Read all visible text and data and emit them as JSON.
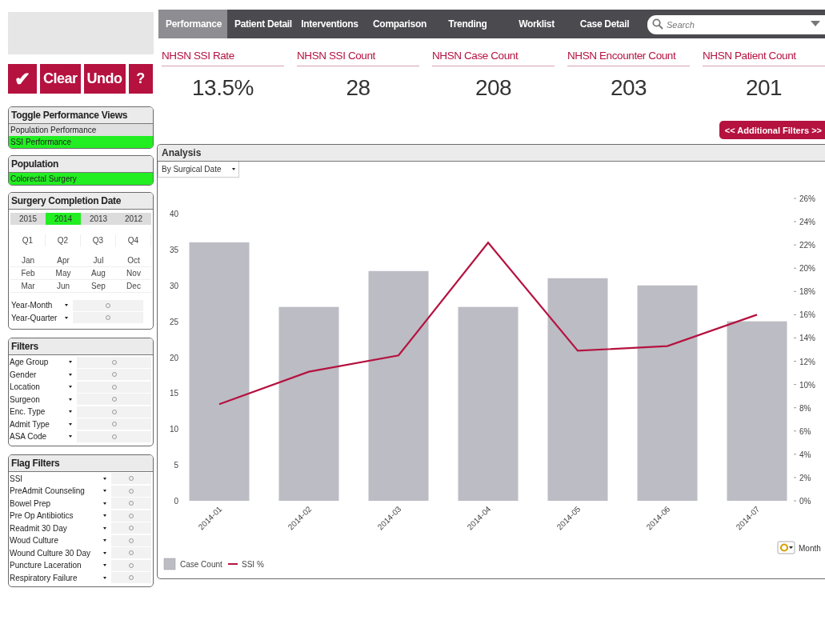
{
  "toolbar_buttons": [
    {
      "kind": "icon",
      "label": "✔"
    },
    {
      "kind": "text",
      "label": "Clear"
    },
    {
      "kind": "text",
      "label": "Undo"
    },
    {
      "kind": "text",
      "label": "?"
    }
  ],
  "sidebar": {
    "toggle_views": {
      "title": "Toggle Performance Views",
      "items": [
        {
          "label": "Population Performance",
          "selected": false
        },
        {
          "label": "SSI Performance",
          "selected": true
        }
      ]
    },
    "population": {
      "title": "Population",
      "items": [
        {
          "label": "Colorectal Surgery",
          "selected": true
        }
      ]
    },
    "surgery_date": {
      "title": "Surgery Completion Date",
      "years": [
        {
          "label": "2015",
          "selected": false
        },
        {
          "label": "2014",
          "selected": true
        },
        {
          "label": "2013",
          "selected": false
        },
        {
          "label": "2012",
          "selected": false
        }
      ],
      "quarters": [
        "Q1",
        "Q2",
        "Q3",
        "Q4"
      ],
      "months": [
        [
          "Jan",
          "Apr",
          "Jul",
          "Oct"
        ],
        [
          "Feb",
          "May",
          "Aug",
          "Nov"
        ],
        [
          "Mar",
          "Jun",
          "Sep",
          "Dec"
        ]
      ],
      "fields": [
        {
          "label": "Year-Month"
        },
        {
          "label": "Year-Quarter"
        }
      ]
    },
    "filters": {
      "title": "Filters",
      "items": [
        {
          "label": "Age Group"
        },
        {
          "label": "Gender"
        },
        {
          "label": "Location"
        },
        {
          "label": "Surgeon"
        },
        {
          "label": "Enc. Type"
        },
        {
          "label": "Admit Type"
        },
        {
          "label": "ASA Code"
        }
      ]
    },
    "flag_filters": {
      "title": "Flag Filters",
      "items": [
        {
          "label": "SSI"
        },
        {
          "label": "PreAdmit Counseling"
        },
        {
          "label": "Bowel Prep"
        },
        {
          "label": "Pre Op Antibiotics"
        },
        {
          "label": "Readmit 30 Day"
        },
        {
          "label": "Woud Culture"
        },
        {
          "label": "Wound Culture 30 Day"
        },
        {
          "label": "Puncture Laceration"
        },
        {
          "label": "Respiratory Failure"
        }
      ]
    }
  },
  "tabs": [
    {
      "label": "Performance",
      "selected": true
    },
    {
      "label": "Patient Detail",
      "selected": false
    },
    {
      "label": "Interventions",
      "selected": false
    },
    {
      "label": "Comparison",
      "selected": false
    },
    {
      "label": "Trending",
      "selected": false
    },
    {
      "label": "Worklist",
      "selected": false
    },
    {
      "label": "Case Detail",
      "selected": false
    }
  ],
  "search": {
    "placeholder": "Search"
  },
  "kpis": [
    {
      "label": "NHSN SSI Rate",
      "value": "13.5%"
    },
    {
      "label": "NHSN SSI Count",
      "value": "28"
    },
    {
      "label": "NHSN Case Count",
      "value": "208"
    },
    {
      "label": "NHSN Encounter Count",
      "value": "203"
    },
    {
      "label": "NHSN Patient Count",
      "value": "201"
    }
  ],
  "additional_filters_button": "<< Additional Filters >>",
  "analysis": {
    "title": "Analysis",
    "dropdown": "By Surgical Date",
    "dimension_label": "Month",
    "chart_data": {
      "type": "bar",
      "categories": [
        "2014-01",
        "2014-02",
        "2014-03",
        "2014-04",
        "2014-05",
        "2014-06",
        "2014-07"
      ],
      "series": [
        {
          "name": "Case Count",
          "type": "bar",
          "color": "#bcbcc4",
          "values": [
            36,
            27,
            32,
            27,
            31,
            30,
            25
          ]
        },
        {
          "name": "SSI %",
          "type": "line",
          "axis": "y2",
          "color": "#b5123f",
          "values": [
            8.3,
            11.1,
            12.5,
            22.2,
            12.9,
            13.3,
            16.0
          ]
        }
      ],
      "legend": "bottom-left",
      "ylim": [
        0,
        40
      ],
      "yticks": [
        0,
        5,
        10,
        15,
        20,
        25,
        30,
        35,
        40
      ],
      "y2lim": [
        0,
        26
      ],
      "y2ticks": [
        {
          "value": 0,
          "label": "0%"
        },
        {
          "value": 2,
          "label": "2%"
        },
        {
          "value": 4,
          "label": "4%"
        },
        {
          "value": 6,
          "label": "6%"
        },
        {
          "value": 8,
          "label": "8%"
        },
        {
          "value": 10,
          "label": "10%"
        },
        {
          "value": 12,
          "label": "12%"
        },
        {
          "value": 14,
          "label": "14%"
        },
        {
          "value": 16,
          "label": "16%"
        },
        {
          "value": 18,
          "label": "18%"
        },
        {
          "value": 20,
          "label": "20%"
        },
        {
          "value": 22,
          "label": "22%"
        },
        {
          "value": 24,
          "label": "24%"
        },
        {
          "value": 26,
          "label": "26%"
        }
      ]
    }
  }
}
